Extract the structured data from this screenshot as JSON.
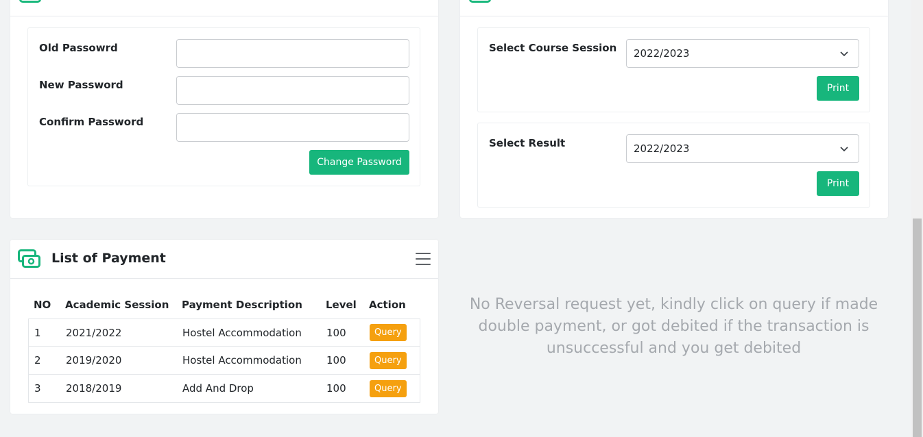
{
  "password_card": {
    "fields": [
      {
        "label": "Old Passowrd",
        "value": "",
        "placeholder": ""
      },
      {
        "label": "New Password",
        "value": "",
        "placeholder": ""
      },
      {
        "label": "Confirm Password",
        "value": "",
        "placeholder": ""
      }
    ],
    "submit_label": "Change Password"
  },
  "course_card": {
    "course_session": {
      "label": "Select Course Session",
      "selected": "2022/2023",
      "button": "Print"
    },
    "result": {
      "label": "Select Result",
      "selected": "2022/2023",
      "button": "Print"
    }
  },
  "payment_card": {
    "title": "List of Payment",
    "icon": "money-icon",
    "columns": [
      "NO",
      "Academic Session",
      "Payment Description",
      "Level",
      "Action"
    ],
    "rows": [
      {
        "no": "1",
        "session": "2021/2022",
        "description": "Hostel Accommodation",
        "level": "100",
        "action": "Query"
      },
      {
        "no": "2",
        "session": "2019/2020",
        "description": "Hostel Accommodation",
        "level": "100",
        "action": "Query"
      },
      {
        "no": "3",
        "session": "2018/2019",
        "description": "Add And Drop",
        "level": "100",
        "action": "Query"
      }
    ]
  },
  "reversal": {
    "message": "No Reversal request yet, kindly click on query if made double payment, or got debited if the transaction is unsuccessful and you get debited"
  },
  "colors": {
    "accent": "#17b67c",
    "query": "#f5a00f",
    "muted_text": "#a5a9ae",
    "background": "#f1f3f4"
  }
}
